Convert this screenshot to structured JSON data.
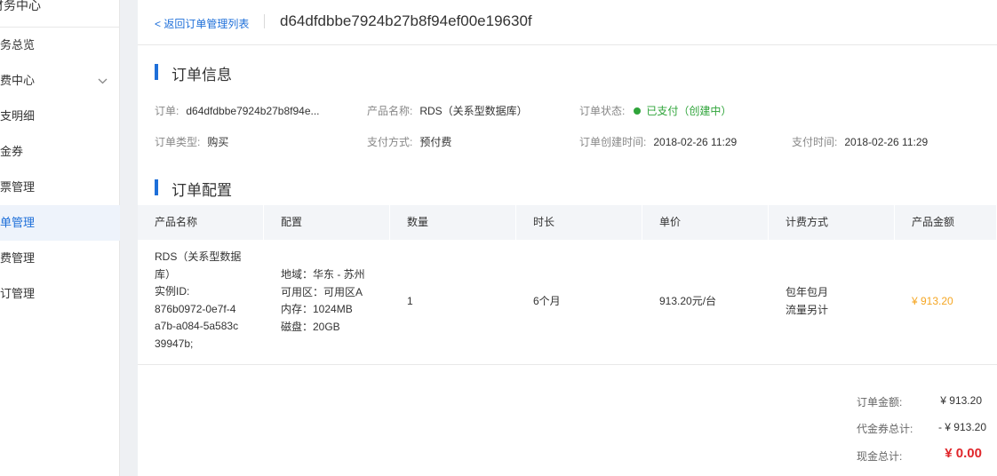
{
  "sidebar": {
    "title": "财务中心",
    "items": [
      {
        "label": "财务总览"
      },
      {
        "label": "消费中心",
        "chevron": "chevron-down-icon"
      },
      {
        "label": "收支明细"
      },
      {
        "label": "代金券"
      },
      {
        "label": "发票管理"
      },
      {
        "label": "订单管理",
        "active": true
      },
      {
        "label": "续费管理"
      },
      {
        "label": "退订管理"
      }
    ]
  },
  "header": {
    "back_link": "< 返回订单管理列表",
    "order_id": "d64dfdbbe7924b27b8f94ef00e19630f"
  },
  "order_info": {
    "section_title": "订单信息",
    "order_label": "订单:",
    "order_value": "d64dfdbbe7924b27b8f94e...",
    "product_name_label": "产品名称:",
    "product_name_value": "RDS（关系型数据库）",
    "status_label": "订单状态:",
    "status_value": "已支付（创建中）",
    "type_label": "订单类型:",
    "type_value": "购买",
    "payment_label": "支付方式:",
    "payment_value": "预付费",
    "created_label": "订单创建时间:",
    "created_value": "2018-02-26 11:29",
    "paid_label": "支付时间:",
    "paid_value": "2018-02-26 11:29"
  },
  "order_config": {
    "section_title": "订单配置",
    "columns": [
      "产品名称",
      "配置",
      "数量",
      "时长",
      "单价",
      "计费方式",
      "产品金额"
    ],
    "row": {
      "product_lines": [
        "RDS（关系型数据",
        "库）",
        "实例ID:",
        "876b0972-0e7f-4",
        "a7b-a084-5a583c",
        "39947b;"
      ],
      "config_lines": [
        "地域：华东 - 苏州",
        "可用区：可用区A",
        "内存：1024MB",
        "磁盘：20GB"
      ],
      "quantity": "1",
      "duration": "6个月",
      "unit_price": "913.20元/台",
      "billing_lines": [
        "包年包月",
        "流量另计"
      ],
      "amount": "¥ 913.20"
    }
  },
  "summary": {
    "order_amount_label": "订单金额:",
    "order_amount_value": "¥ 913.20",
    "voucher_label": "代金券总计:",
    "voucher_value": "- ¥ 913.20",
    "cash_label": "现金总计:",
    "cash_value": "¥ 0.00"
  },
  "colors": {
    "accent": "#1e6fd9",
    "success": "#2fa43a",
    "amount": "#f5a623",
    "cash": "#e0262b"
  }
}
